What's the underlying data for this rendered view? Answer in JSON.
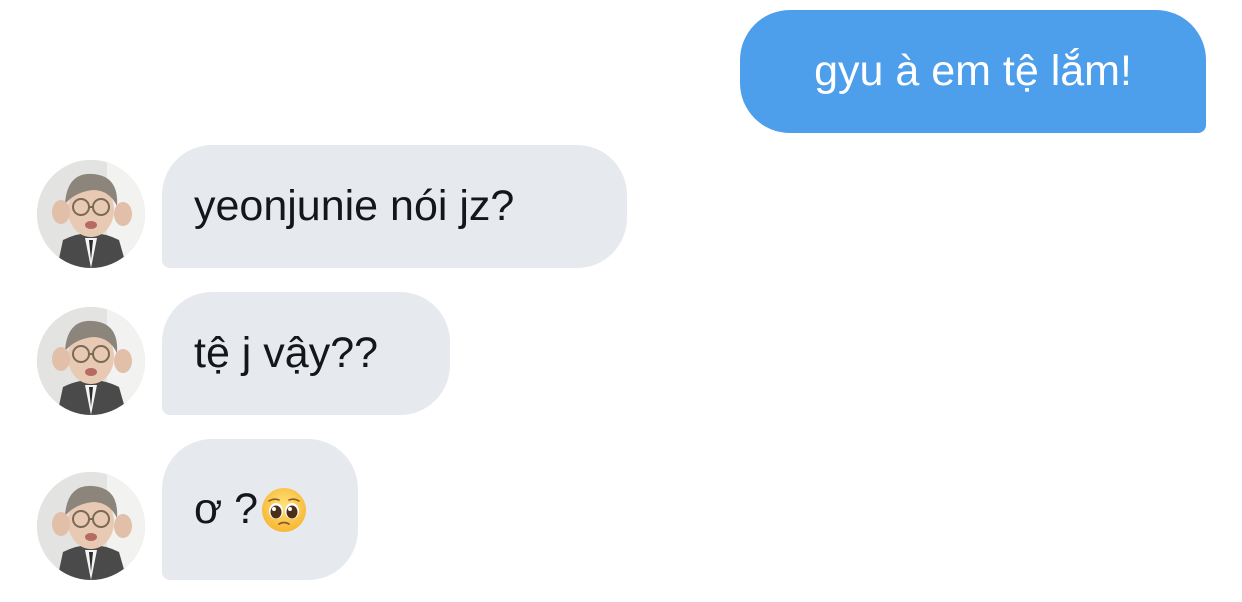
{
  "conversation": {
    "outgoing": [
      {
        "text": "gyu à em tệ lắm!"
      }
    ],
    "incoming": [
      {
        "text": "yeonjunie nói jz?",
        "avatar": "avatar-photo"
      },
      {
        "text": "tệ j vậy??",
        "avatar": "avatar-photo"
      },
      {
        "text": "ơ ?",
        "emoji": "pleading-face-icon",
        "avatar": "avatar-photo"
      }
    ]
  },
  "colors": {
    "outgoing_bubble": "#4d9eeb",
    "incoming_bubble": "#e6e9ee",
    "outgoing_text": "#ffffff",
    "incoming_text": "#14171a",
    "background": "#ffffff"
  }
}
